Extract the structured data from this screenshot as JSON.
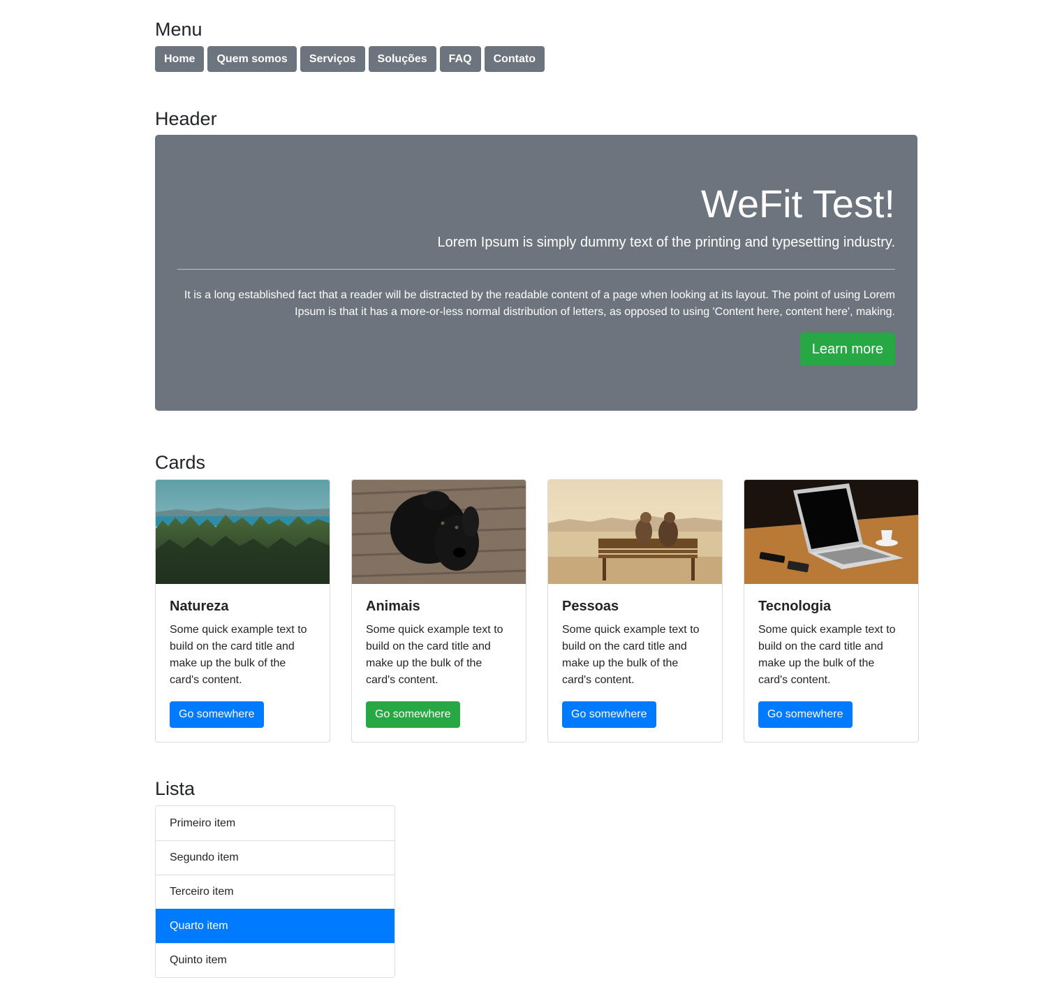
{
  "sections": {
    "menu": "Menu",
    "header": "Header",
    "cards": "Cards",
    "list": "Lista"
  },
  "menu": {
    "items": [
      "Home",
      "Quem somos",
      "Serviços",
      "Soluções",
      "FAQ",
      "Contato"
    ],
    "color": "#6c757d"
  },
  "jumbotron": {
    "title": "WeFit Test!",
    "lead": "Lorem Ipsum is simply dummy text of the printing and typesetting industry.",
    "text": "It is a long established fact that a reader will be distracted by the readable content of a page when looking at its layout. The point of using Lorem Ipsum is that it has a more-or-less normal distribution of letters, as opposed to using 'Content here, content here', making.",
    "button": "Learn more",
    "background": "#6c757d",
    "button_color": "#28a745"
  },
  "cards": [
    {
      "title": "Natureza",
      "text": "Some quick example text to build on the card title and make up the bulk of the card's content.",
      "button": "Go somewhere",
      "button_color": "#007bff",
      "image": "forest-lake-photo"
    },
    {
      "title": "Animais",
      "text": "Some quick example text to build on the card title and make up the bulk of the card's content.",
      "button": "Go somewhere",
      "button_color": "#28a745",
      "image": "black-puppy-photo"
    },
    {
      "title": "Pessoas",
      "text": "Some quick example text to build on the card title and make up the bulk of the card's content.",
      "button": "Go somewhere",
      "button_color": "#007bff",
      "image": "couple-on-bench-photo"
    },
    {
      "title": "Tecnologia",
      "text": "Some quick example text to build on the card title and make up the bulk of the card's content.",
      "button": "Go somewhere",
      "button_color": "#007bff",
      "image": "laptop-on-table-photo"
    }
  ],
  "list": {
    "items": [
      "Primeiro item",
      "Segundo item",
      "Terceiro item",
      "Quarto item",
      "Quinto item"
    ],
    "active_index": 3,
    "active_color": "#007bff"
  }
}
